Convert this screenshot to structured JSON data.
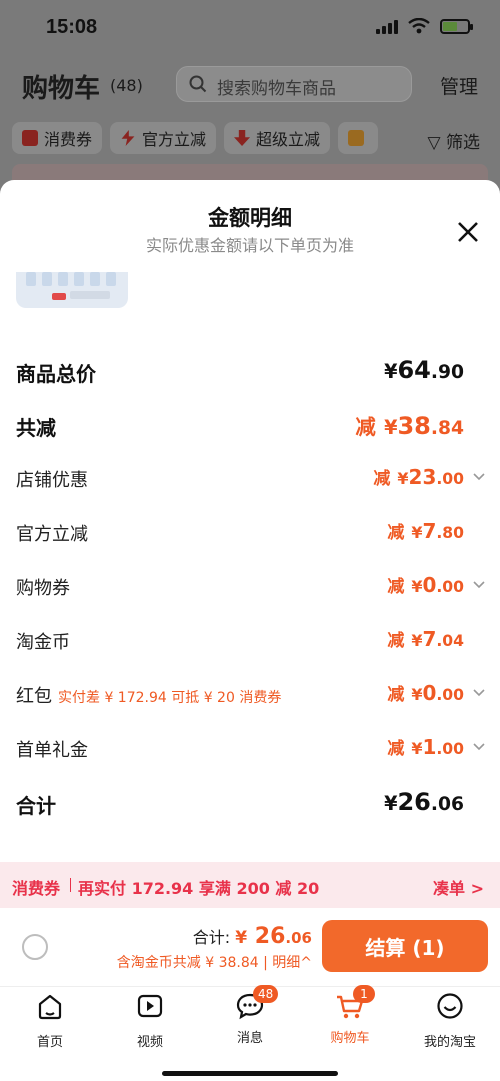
{
  "status": {
    "time": "15:08"
  },
  "cart": {
    "title": "购物车",
    "count": "(48)",
    "search_placeholder": "搜索购物车商品",
    "manage": "管理",
    "chips": [
      "消费券",
      "官方立减",
      "超级立减"
    ],
    "filter": "筛选"
  },
  "sheet": {
    "title": "金额明细",
    "subtitle": "实际优惠金额请以下单页为准",
    "rows": [
      {
        "label": "商品总价",
        "prefix": "",
        "currency": "¥",
        "int": "64",
        "dec": ".90"
      },
      {
        "label": "共减",
        "prefix": "减",
        "currency": "¥",
        "int": "38",
        "dec": ".84"
      },
      {
        "label": "店铺优惠",
        "prefix": "减",
        "currency": "¥",
        "int": "23",
        "dec": ".00"
      },
      {
        "label": "官方立减",
        "prefix": "减",
        "currency": "¥",
        "int": "7",
        "dec": ".80"
      },
      {
        "label": "购物券",
        "prefix": "减",
        "currency": "¥",
        "int": "0",
        "dec": ".00"
      },
      {
        "label": "淘金币",
        "prefix": "减",
        "currency": "¥",
        "int": "7",
        "dec": ".04"
      },
      {
        "label": "红包",
        "note": "实付差 ¥ 172.94 可抵 ¥ 20 消费券",
        "prefix": "减",
        "currency": "¥",
        "int": "0",
        "dec": ".00"
      },
      {
        "label": "首单礼金",
        "prefix": "减",
        "currency": "¥",
        "int": "1",
        "dec": ".00"
      },
      {
        "label": "合计",
        "prefix": "",
        "currency": "¥",
        "int": "26",
        "dec": ".06"
      }
    ]
  },
  "promo": {
    "tag": "消费券",
    "text": "再实付 172.94 享满 200 减 20",
    "cta": "凑单 >"
  },
  "checkout": {
    "total_label": "合计:",
    "total_currency": "¥",
    "total_int": "26",
    "total_dec": ".06",
    "saving": "含淘金币共减 ¥ 38.84 | 明细^",
    "button": "结算 (1)"
  },
  "tabs": [
    {
      "label": "首页"
    },
    {
      "label": "视频"
    },
    {
      "label": "消息",
      "badge": "48"
    },
    {
      "label": "购物车",
      "badge": "1"
    },
    {
      "label": "我的淘宝"
    }
  ],
  "colors": {
    "accent": "#ef5a24",
    "promo": "#e8324a"
  }
}
